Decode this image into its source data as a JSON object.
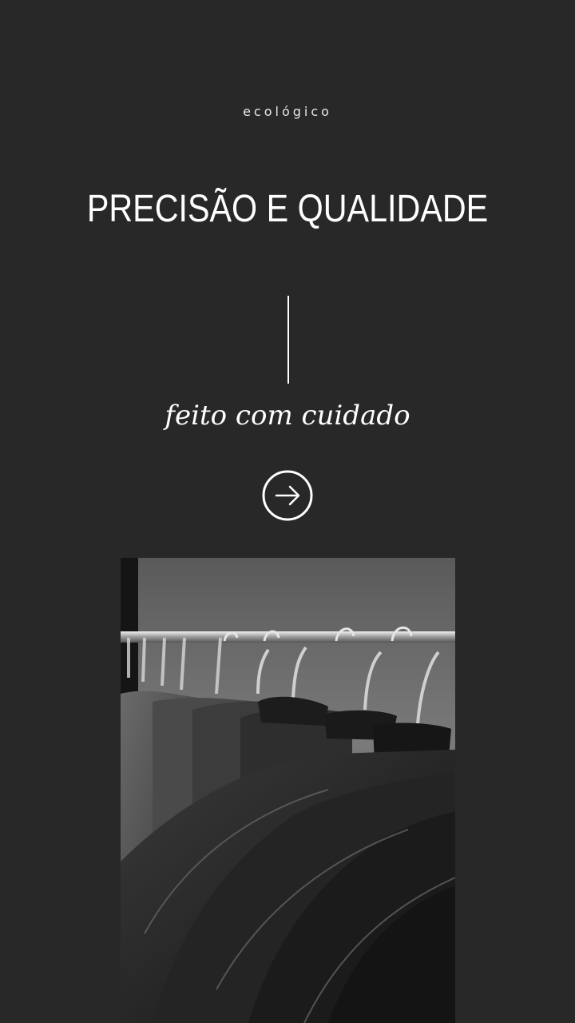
{
  "hero": {
    "eyebrow": "ecológico",
    "headline": "PRECISÃO E QUALIDADE",
    "tagline": "feito com cuidado"
  },
  "cta": {
    "icon": "arrow-right-icon"
  },
  "image": {
    "subject": "clothing-rack-photo"
  },
  "colors": {
    "background": "#282828",
    "text": "#ffffff"
  }
}
